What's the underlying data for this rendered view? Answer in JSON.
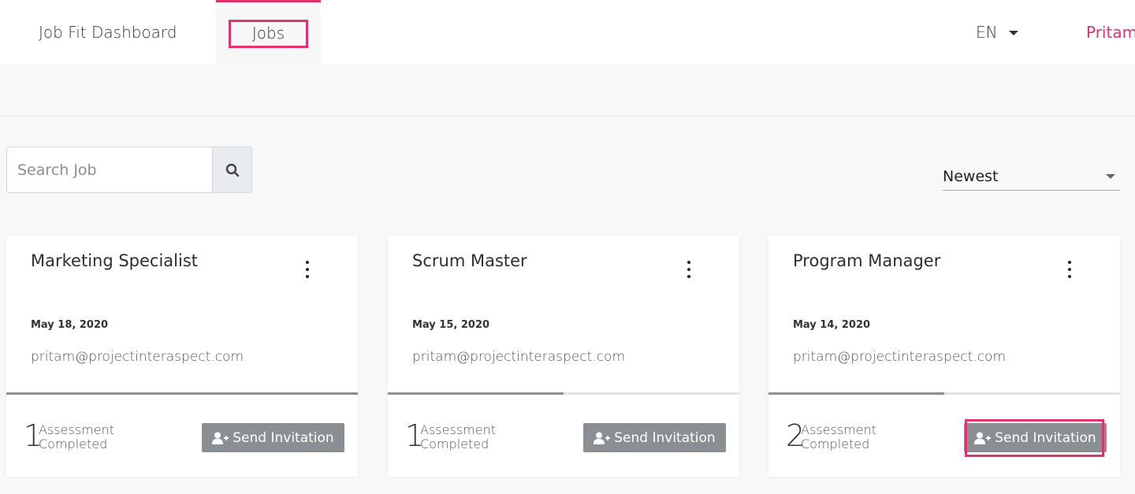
{
  "nav": {
    "dashboard_label": "Job Fit Dashboard",
    "jobs_label": "Jobs",
    "language": "EN",
    "user": "Pritam"
  },
  "search": {
    "placeholder": "Search Job",
    "value": ""
  },
  "sort": {
    "selected": "Newest"
  },
  "jobs": [
    {
      "title": "Marketing Specialist",
      "date": "May 18, 2020",
      "email": "pritam@projectinteraspect.com",
      "progress": 1.0,
      "count": "1",
      "count_label_1": "Assessment",
      "count_label_2": "Completed",
      "button": "Send Invitation",
      "highlighted": false
    },
    {
      "title": "Scrum Master",
      "date": "May 15, 2020",
      "email": "pritam@projectinteraspect.com",
      "progress": 0.5,
      "count": "1",
      "count_label_1": "Assessment",
      "count_label_2": "Completed",
      "button": "Send Invitation",
      "highlighted": false
    },
    {
      "title": "Program Manager",
      "date": "May 14, 2020",
      "email": "pritam@projectinteraspect.com",
      "progress": 0.5,
      "count": "2",
      "count_label_1": "Assessment",
      "count_label_2": "Completed",
      "button": "Send Invitation",
      "highlighted": true
    }
  ],
  "colors": {
    "accent": "#e0336b",
    "button_gray": "#8a8f94",
    "background": "#f8f8f8"
  },
  "icons": {
    "search": "search-icon",
    "more": "more-vertical-icon",
    "invite": "user-plus-icon",
    "dropdown": "caret-down-icon"
  }
}
